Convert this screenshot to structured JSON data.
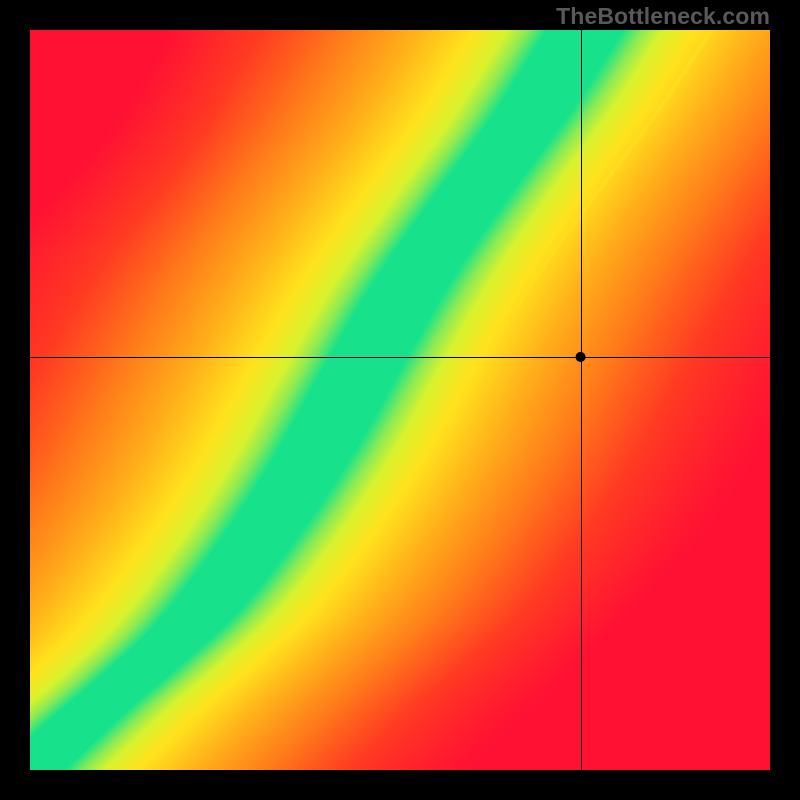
{
  "watermark": "TheBottleneck.com",
  "colors": {
    "background": "#000000",
    "watermark": "#595959"
  },
  "chart_data": {
    "type": "heatmap",
    "title": "",
    "xlabel": "",
    "ylabel": "",
    "x_range": [
      0,
      1
    ],
    "y_range": [
      0,
      1
    ],
    "crosshair": {
      "x": 0.744,
      "y": 0.558
    },
    "marker": {
      "x": 0.744,
      "y": 0.558,
      "radius_px": 5
    },
    "optimal_curve": {
      "description": "green band center, monotonic S-shaped curve from (0,0) to (~0.75,1)",
      "points": [
        [
          0.0,
          0.0
        ],
        [
          0.08,
          0.075
        ],
        [
          0.15,
          0.135
        ],
        [
          0.22,
          0.2
        ],
        [
          0.3,
          0.3
        ],
        [
          0.38,
          0.42
        ],
        [
          0.45,
          0.545
        ],
        [
          0.52,
          0.665
        ],
        [
          0.6,
          0.78
        ],
        [
          0.68,
          0.89
        ],
        [
          0.75,
          1.0
        ]
      ]
    },
    "color_stops": [
      {
        "t": 0.0,
        "color": "#ff1133"
      },
      {
        "t": 0.22,
        "color": "#ff3a22"
      },
      {
        "t": 0.42,
        "color": "#ff7a1a"
      },
      {
        "t": 0.62,
        "color": "#ffb21a"
      },
      {
        "t": 0.78,
        "color": "#ffe21d"
      },
      {
        "t": 0.88,
        "color": "#d8f22e"
      },
      {
        "t": 0.94,
        "color": "#8bea55"
      },
      {
        "t": 1.0,
        "color": "#17e28b"
      }
    ],
    "band_halfwidth_x": 0.055,
    "yellow_halfwidth_x": 0.14,
    "legend": null
  }
}
